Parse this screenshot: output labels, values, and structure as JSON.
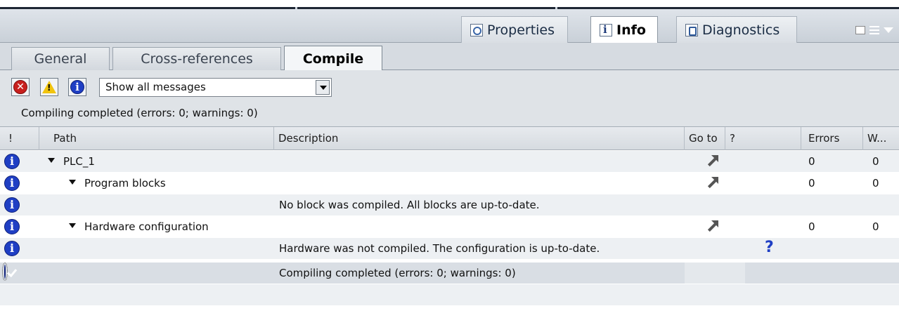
{
  "header_tabs": [
    {
      "label": "Properties",
      "icon": "properties-icon"
    },
    {
      "label": "Info",
      "icon": "info-icon"
    },
    {
      "label": "Diagnostics",
      "icon": "diagnostics-icon"
    }
  ],
  "sub_tabs": [
    {
      "label": "General"
    },
    {
      "label": "Cross-references"
    },
    {
      "label": "Compile"
    }
  ],
  "toolbar": {
    "filter_value": "Show all messages",
    "info_glyph": "i",
    "error_glyph": "✕",
    "warning_glyph": "!"
  },
  "status_text": "Compiling completed (errors: 0; warnings: 0)",
  "columns": [
    "!",
    "Path",
    "Description",
    "Go to",
    "?",
    "Errors",
    "W..."
  ],
  "rows": [
    {
      "icon": "info-icon",
      "path": "PLC_1",
      "description": "",
      "goto": true,
      "help": false,
      "errors": "0",
      "warnings": "0"
    },
    {
      "icon": "info-icon",
      "path": "Program blocks",
      "description": "",
      "goto": true,
      "help": false,
      "errors": "0",
      "warnings": "0"
    },
    {
      "icon": "info-icon",
      "path": "",
      "description": "No block was compiled. All blocks are up-to-date.",
      "goto": false,
      "help": false,
      "errors": "",
      "warnings": ""
    },
    {
      "icon": "info-icon",
      "path": "Hardware configuration",
      "description": "",
      "goto": true,
      "help": false,
      "errors": "0",
      "warnings": "0"
    },
    {
      "icon": "info-icon",
      "path": "",
      "description": "Hardware was not compiled. The configuration is up-to-date.",
      "goto": false,
      "help": true,
      "errors": "",
      "warnings": ""
    },
    {
      "icon": "ok-icon",
      "path": "",
      "description": "Compiling completed (errors: 0; warnings: 0)",
      "goto": false,
      "help": false,
      "errors": "",
      "warnings": ""
    }
  ],
  "help_glyph": "?",
  "colors": {
    "info_blue": "#1f3fc4",
    "error_red": "#c8201e",
    "warning_yellow": "#f1c40f"
  }
}
